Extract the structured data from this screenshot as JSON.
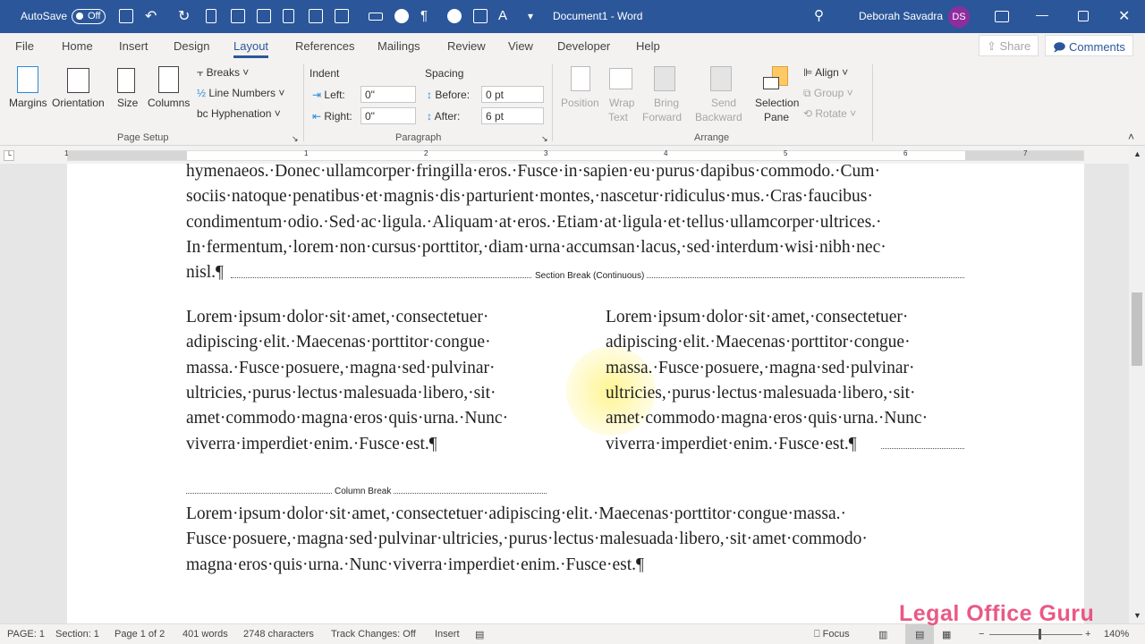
{
  "titlebar": {
    "autosave_label": "AutoSave",
    "autosave_state": "Off",
    "document_title": "Document1  -  Word",
    "user_name": "Deborah Savadra",
    "user_initials": "DS",
    "avatar_color": "#8e2d9e",
    "accent": "#2b579a"
  },
  "tabs": [
    "File",
    "Home",
    "Insert",
    "Design",
    "Layout",
    "References",
    "Mailings",
    "Review",
    "View",
    "Developer",
    "Help"
  ],
  "active_tab": "Layout",
  "share_label": "Share",
  "comments_label": "Comments",
  "ribbon": {
    "page_setup": {
      "margins": "Margins",
      "orientation": "Orientation",
      "size": "Size",
      "columns": "Columns",
      "breaks": "Breaks",
      "line_numbers": "Line Numbers",
      "hyphenation": "Hyphenation",
      "group": "Page Setup"
    },
    "paragraph": {
      "indent": "Indent",
      "spacing": "Spacing",
      "left_label": "Left:",
      "left_value": "0\"",
      "right_label": "Right:",
      "right_value": "0\"",
      "before_label": "Before:",
      "before_value": "0 pt",
      "after_label": "After:",
      "after_value": "6 pt",
      "group": "Paragraph"
    },
    "arrange": {
      "position": "Position",
      "wrap_text": [
        "Wrap",
        "Text"
      ],
      "bring_forward": [
        "Bring",
        "Forward"
      ],
      "send_backward": [
        "Send",
        "Backward"
      ],
      "selection_pane": [
        "Selection",
        "Pane"
      ],
      "align": "Align",
      "group_btn": "Group",
      "rotate": "Rotate",
      "group": "Arrange"
    }
  },
  "ruler": {
    "numbers": [
      "1",
      "1",
      "2",
      "3",
      "4",
      "5",
      "6",
      "7"
    ]
  },
  "document": {
    "top_lines": [
      "hymenaeos.·Donec·ullamcorper·fringilla·eros.·Fusce·in·sapien·eu·purus·dapibus·commodo.·Cum·",
      "sociis·natoque·penatibus·et·magnis·dis·parturient·montes,·nascetur·ridiculus·mus.·Cras·faucibus·",
      "condimentum·odio.·Sed·ac·ligula.·Aliquam·at·eros.·Etiam·at·ligula·et·tellus·ullamcorper·ultrices.·",
      "In·fermentum,·lorem·non·cursus·porttitor,·diam·urna·accumsan·lacus,·sed·interdum·wisi·nibh·nec·",
      "nisl.¶"
    ],
    "section_break_label": "Section Break (Continuous)",
    "left_column": [
      "Lorem·ipsum·dolor·sit·amet,·consectetuer·",
      "adipiscing·elit.·Maecenas·porttitor·congue·",
      "massa.·Fusce·posuere,·magna·sed·pulvinar·",
      "ultricies,·purus·lectus·malesuada·libero,·sit·",
      "amet·commodo·magna·eros·quis·urna.·Nunc·",
      "viverra·imperdiet·enim.·Fusce·est.¶"
    ],
    "right_column": [
      "Lorem·ipsum·dolor·sit·amet,·consectetuer·",
      "adipiscing·elit.·Maecenas·porttitor·congue·",
      "massa.·Fusce·posuere,·magna·sed·pulvinar·",
      "ultricies,·purus·lectus·malesuada·libero,·sit·",
      "amet·commodo·magna·eros·quis·urna.·Nunc·",
      "viverra·imperdiet·enim.·Fusce·est.¶"
    ],
    "column_break_label": "Column Break",
    "bottom_lines": [
      "Lorem·ipsum·dolor·sit·amet,·consectetuer·adipiscing·elit.·Maecenas·porttitor·congue·massa.·",
      "Fusce·posuere,·magna·sed·pulvinar·ultricies,·purus·lectus·malesuada·libero,·sit·amet·commodo·",
      "magna·eros·quis·urna.·Nunc·viverra·imperdiet·enim.·Fusce·est.¶"
    ]
  },
  "status": {
    "page": "PAGE: 1",
    "section": "Section: 1",
    "page_of": "Page 1 of 2",
    "words": "401 words",
    "characters": "2748 characters",
    "track_changes": "Track Changes: Off",
    "insert": "Insert",
    "focus": "Focus",
    "zoom": "140%"
  },
  "watermark": "Legal Office Guru"
}
